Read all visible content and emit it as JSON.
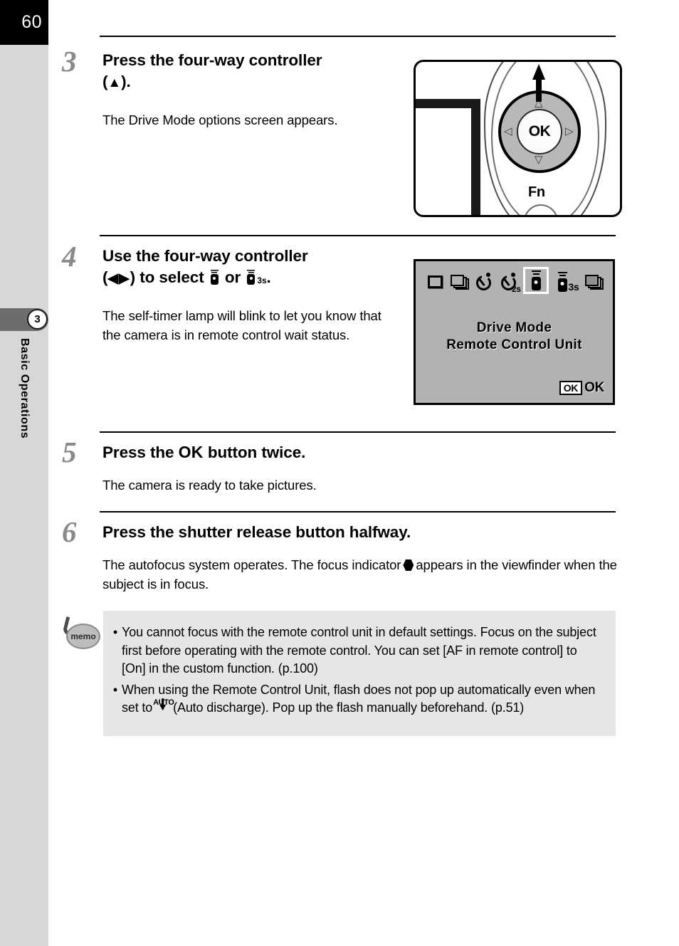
{
  "page": {
    "number": "60",
    "chapter_number": "3",
    "chapter_title": "Basic Operations"
  },
  "steps": [
    {
      "number": "3",
      "heading_line1": "Press the four-way controller",
      "heading_line2_open": "(",
      "heading_arrow": "▲",
      "heading_line2_close": ").",
      "body": "The Drive Mode options screen appears."
    },
    {
      "number": "4",
      "heading_line1": "Use the four-way controller",
      "heading_line2_open": "(",
      "heading_arrow_left": "◀",
      "heading_arrow_right": "▶",
      "heading_line2_mid": ") to select",
      "heading_or": "or",
      "heading_sub_3s": "3s",
      "heading_line2_close": ".",
      "body": "The self-timer lamp will blink to let you know that the camera is in remote control wait status."
    },
    {
      "number": "5",
      "heading_pre": "Press the",
      "heading_ok": "OK",
      "heading_post": "button twice.",
      "body": "The camera is ready to take pictures."
    },
    {
      "number": "6",
      "heading": "Press the shutter release button halfway.",
      "body_pre": "The autofocus system operates. The focus indicator",
      "body_post": "appears in the viewfinder when the subject is in focus."
    }
  ],
  "figure_controller": {
    "ok_label": "OK",
    "fn_label": "Fn",
    "arrow_up": "△",
    "arrow_down": "▽",
    "arrow_left": "◁",
    "arrow_right": "▷"
  },
  "figure_drivemode": {
    "icons": [
      {
        "name": "single-frame-shooting-icon",
        "label": "",
        "selected": false
      },
      {
        "name": "continuous-shooting-icon",
        "label": "",
        "selected": false
      },
      {
        "name": "self-timer-12s-icon",
        "label": "",
        "selected": false
      },
      {
        "name": "self-timer-2s-icon",
        "label": "2s",
        "selected": false
      },
      {
        "name": "remote-control-icon",
        "label": "",
        "selected": true
      },
      {
        "name": "remote-control-3s-icon",
        "label": "3s",
        "selected": false
      },
      {
        "name": "exposure-bracketing-icon",
        "label": "",
        "selected": false
      }
    ],
    "title_line1": "Drive Mode",
    "title_line2": "Remote Control Unit",
    "ok_badge": "OK",
    "ok_text": "OK"
  },
  "memo": {
    "icon_label": "memo",
    "bullet": "•",
    "items": [
      {
        "text": "You cannot focus with the remote control unit in default settings. Focus on the subject first before operating with the remote control. You can set [AF in remote control] to [On] in the custom function. (p.100)"
      },
      {
        "text_pre": "When using the Remote Control Unit, flash does not pop up automatically even when set to",
        "icon_text": "AUTO",
        "text_post": "(Auto discharge). Pop up the flash manually beforehand. (p.51)"
      }
    ]
  },
  "colors": {
    "page_number_bg": "#000000",
    "rail_bg": "#d7d7d7",
    "chapter_tab_bg": "#6d6d6d",
    "step_number": "#8a8a8a",
    "lcd_bg": "#b2b2b2",
    "memo_bg": "#e6e6e6"
  }
}
